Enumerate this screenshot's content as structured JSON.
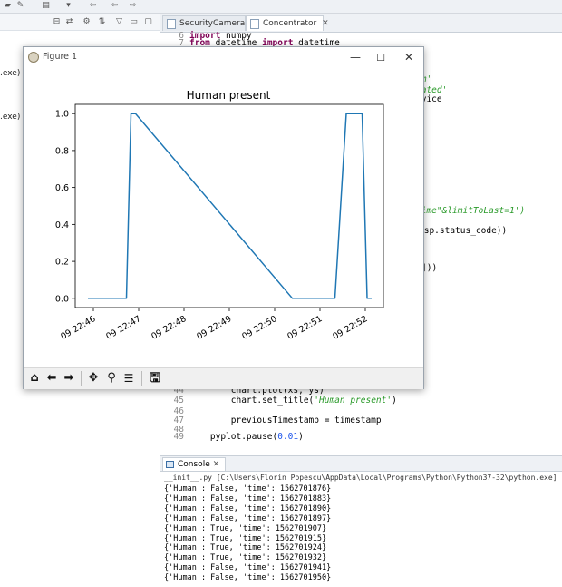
{
  "left_panel": {
    "lines": [
      ".exe)",
      ".exe)"
    ]
  },
  "editor": {
    "tabs": [
      {
        "label": "SecurityCamera",
        "active": false
      },
      {
        "label": "Concentrator",
        "active": true
      }
    ],
    "lines": [
      {
        "n": "6",
        "code": "import numpy"
      },
      {
        "n": "7",
        "code": "from datetime import datetime"
      },
      {
        "n": "",
        "code": "om'"
      },
      {
        "n": "",
        "code": "dated'"
      },
      {
        "n": "",
        "code": "evice"
      },
      {
        "n": "",
        "code": "time\"&limitToLast=1')"
      },
      {
        "n": "",
        "code": "esp.status_code))"
      },
      {
        "n": "",
        "code": "]))"
      },
      {
        "n": "44",
        "code": "        chart.plot(xs, ys)"
      },
      {
        "n": "45",
        "code": "        chart.set_title('Human present')"
      },
      {
        "n": "46",
        "code": ""
      },
      {
        "n": "47",
        "code": "        previousTimestamp = timestamp"
      },
      {
        "n": "48",
        "code": ""
      },
      {
        "n": "49",
        "code": "    pyplot.pause(0.01)"
      }
    ]
  },
  "console": {
    "tab_label": "Console",
    "header": "__init__.py [C:\\Users\\Florin Popescu\\AppData\\Local\\Programs\\Python\\Python37-32\\python.exe]",
    "output": [
      "{'Human': False, 'time': 1562701876}",
      "{'Human': False, 'time': 1562701883}",
      "{'Human': False, 'time': 1562701890}",
      "{'Human': False, 'time': 1562701897}",
      "{'Human': True, 'time': 1562701907}",
      "{'Human': True, 'time': 1562701915}",
      "{'Human': True, 'time': 1562701924}",
      "{'Human': True, 'time': 1562701932}",
      "{'Human': False, 'time': 1562701941}",
      "{'Human': False, 'time': 1562701950}"
    ]
  },
  "figure": {
    "window_title": "Figure 1",
    "toolbar_icons": [
      "home-icon",
      "back-arrow-icon",
      "forward-arrow-icon",
      "pan-icon",
      "zoom-icon",
      "configure-subplots-icon",
      "save-icon"
    ]
  },
  "chart_data": {
    "type": "line",
    "title": "Human present",
    "xlabel": "",
    "ylabel": "",
    "x_unit": "minutes after 22:46",
    "x": [
      -0.12,
      0.73,
      0.83,
      0.93,
      4.39,
      5.33,
      5.58,
      5.68,
      5.93,
      6.04,
      6.14
    ],
    "y": [
      0,
      0,
      1,
      1,
      0,
      0,
      1,
      1,
      1,
      0,
      0
    ],
    "xlim": [
      -0.4,
      6.4
    ],
    "ylim": [
      -0.05,
      1.05
    ],
    "x_ticks": [
      0,
      1,
      2,
      3,
      4,
      5,
      6
    ],
    "x_tick_labels": [
      "09 22:46",
      "09 22:47",
      "09 22:48",
      "09 22:49",
      "09 22:50",
      "09 22:51",
      "09 22:52"
    ],
    "y_ticks": [
      0,
      0.2,
      0.4,
      0.6,
      0.8,
      1.0
    ],
    "y_tick_labels": [
      "0.0",
      "0.2",
      "0.4",
      "0.6",
      "0.8",
      "1.0"
    ],
    "color": "#1f77b4",
    "grid": false
  }
}
